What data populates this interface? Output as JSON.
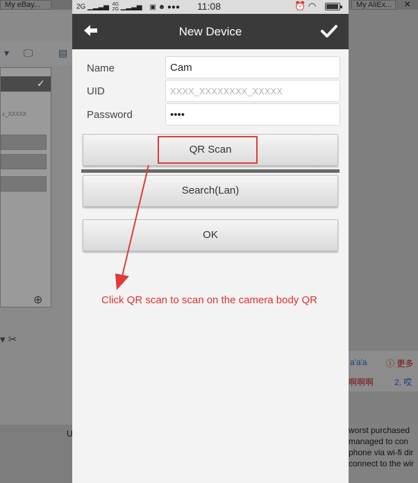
{
  "background": {
    "left_tab": "My eBay...",
    "right_tab": "My AliEx...",
    "close_glyph": "×",
    "right_panel": {
      "line1_text": "a'a'a",
      "line1_more": "更多",
      "line2_text": "啊啊啊",
      "line2_item": "2. 哎"
    },
    "review_lines": [
      "worst purchased",
      "managed to con",
      "phone via wi-fi dir",
      "connect to the wir"
    ],
    "left_partial_letter": "U",
    "inner_window_text": "x_XXXXX"
  },
  "status_bar": {
    "signal_left": "2G",
    "signal_mid_top": "4G",
    "signal_mid_bottom": "2G",
    "time": "11:08"
  },
  "nav": {
    "title": "New Device"
  },
  "form": {
    "name_label": "Name",
    "name_value": "Cam",
    "uid_label": "UID",
    "uid_placeholder": "XXXX_XXXXXXXX_XXXXX",
    "password_label": "Password",
    "password_value": "1234"
  },
  "buttons": {
    "qr_scan": "QR Scan",
    "search_lan": "Search(Lan)",
    "ok": "OK"
  },
  "annotation": {
    "text": "Click QR scan to scan on the camera body QR",
    "color": "#e03030"
  },
  "colors": {
    "nav_bar": "#3a3a3a",
    "highlight": "#e03a3a"
  }
}
